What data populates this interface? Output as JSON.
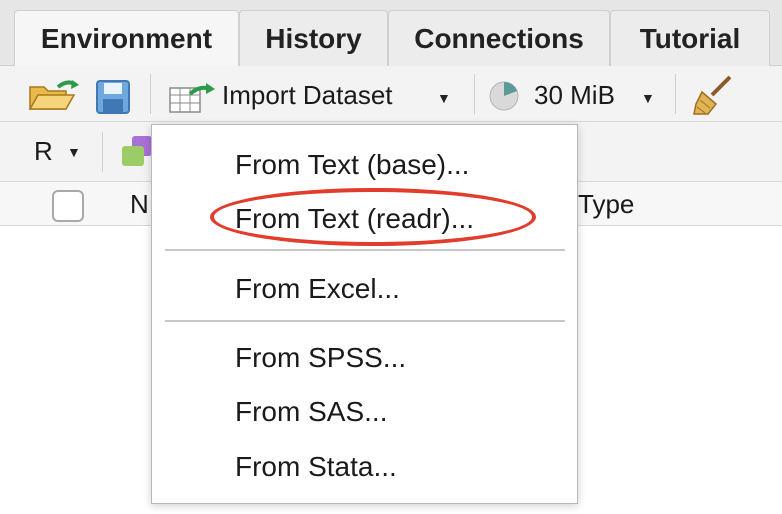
{
  "tabs": [
    {
      "label": "Environment",
      "active": true
    },
    {
      "label": "History"
    },
    {
      "label": "Connections"
    },
    {
      "label": "Tutorial"
    }
  ],
  "toolbar": {
    "import_label": "Import Dataset",
    "memory_label": "30 MiB",
    "language_label": "R"
  },
  "table": {
    "col_name": "N",
    "col_type": "Type"
  },
  "menu": {
    "items": [
      "From Text (base)...",
      "From Text (readr)...",
      "From Excel...",
      "From SPSS...",
      "From SAS...",
      "From Stata..."
    ],
    "highlighted_index": 1,
    "highlight_color": "#e23d2c"
  },
  "icons": [
    "open-folder-icon",
    "save-icon",
    "import-dataset-icon",
    "memory-pie-icon",
    "broom-icon",
    "object-icon"
  ]
}
